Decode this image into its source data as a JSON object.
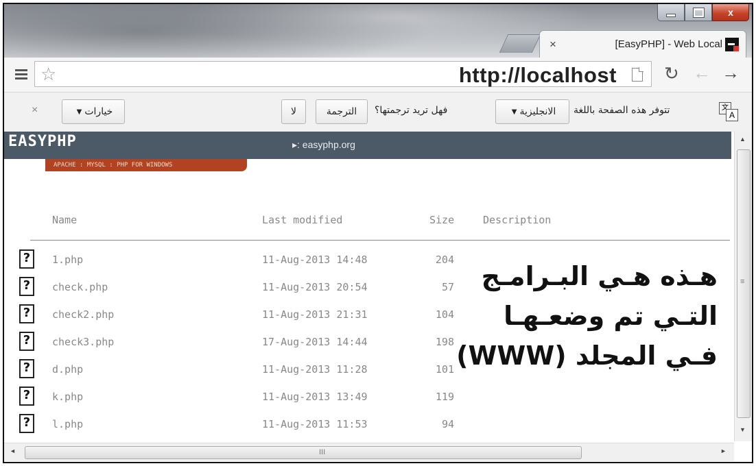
{
  "window": {
    "tab_title": "[EasyPHP] - Web Local",
    "close_glyph": "×",
    "win_close": "x"
  },
  "toolbar": {
    "url": "http://localhost",
    "reload_glyph": "↻",
    "back_glyph": "←",
    "forward_glyph": "→",
    "star_glyph": "☆"
  },
  "translate_bar": {
    "close_glyph": "×",
    "options_label": "خيارات",
    "no_label": "لا",
    "translate_label": "الترجمة",
    "question": "فهل تريد ترجمتها؟",
    "language": "الانجليزية",
    "prefix": "تتوفر هذه الصفحة باللغة",
    "icon_a1": "文",
    "icon_a2": "A"
  },
  "banner": {
    "logo": "EASYPHP",
    "tagline": "APACHE : MYSQL : PHP FOR WINDOWS",
    "site_link": "▸: easyphp.org"
  },
  "listing": {
    "headers": {
      "name": "Name",
      "modified": "Last modified",
      "size": "Size",
      "description": "Description"
    },
    "rows": [
      {
        "name": "1.php",
        "modified": "11-Aug-2013 14:48",
        "size": "204"
      },
      {
        "name": "check.php",
        "modified": "11-Aug-2013 20:54",
        "size": "57"
      },
      {
        "name": "check2.php",
        "modified": "11-Aug-2013 21:31",
        "size": "104"
      },
      {
        "name": "check3.php",
        "modified": "17-Aug-2013 14:44",
        "size": "198"
      },
      {
        "name": "d.php",
        "modified": "11-Aug-2013 11:28",
        "size": "101"
      },
      {
        "name": "k.php",
        "modified": "11-Aug-2013 13:49",
        "size": "119"
      },
      {
        "name": "l.php",
        "modified": "11-Aug-2013 11:53",
        "size": "94"
      }
    ],
    "icon_glyph": "?"
  },
  "annotation": {
    "line1": "هـذه هـي البـرامـج",
    "line2": "التـي تم وضعـهـا",
    "line3": "فـي المجلد (WWW)"
  },
  "scrollbar": {
    "grip_v": "≡",
    "grip_h": "III",
    "up": "▲",
    "down": "▼",
    "left": "◄",
    "right": "►"
  }
}
